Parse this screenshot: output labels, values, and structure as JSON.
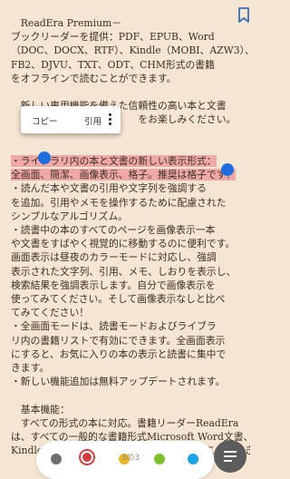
{
  "content": {
    "lines": [
      "　ReadEra Premium－",
      "ブックリーダーを提供：PDF、EPUB、Word",
      "（DOC、DOCX、RTF）、Kindle（MOBI、AZW3）、",
      "FB2、DJVU、TXT、ODT、CHM形式の書籍",
      "をオフラインで読むことができます。",
      "",
      "　新しい専用機能を備えた信頼性の高い本と文書",
      "　　　　　　　　　　　　　をお楽しみください。",
      "",
      "",
      "・ライブラリ内の本と文書の新しい表示形式：",
      "全画面、簡潔、画像表示、格子。推奨は格子です！",
      "・読んだ本や文書の引用や文字列を強調する",
      "を追加。引用やメモを操作するために配慮された",
      "シンプルなアルゴリズム。",
      "・読書中の本のすべてのページを画像表示一本",
      "や文書をすばやく視覚的に移動するのに便利です。",
      "画面表示は昼夜のカラーモードに対応し、強調",
      "表示された文字列、引用、メモ、しおりを表示し、",
      "検索結果を強調表示します。自分で画像表示を",
      "使ってみてください。そして画像表示なしと比べ",
      "てみてください！",
      "・全画面モードは、読書モードおよびライブラ",
      "リ内の書籍リストで有効にできます。全画面表示",
      "にすると、お気に入りの本の表示と読書に集中で",
      "きます。",
      "・新しい機能追加は無料アップデートされます。",
      "",
      "　基本機能：",
      "　すべての形式の本に対応。書籍リーダーReadEra",
      "は、すべての一般的な書籍形式Microsoft Word文書、や",
      "Kindleモバイル形式を、1つのアプリで読むことができます"
    ]
  },
  "popup": {
    "copy": "コピー",
    "quote": "引用"
  },
  "footer": {
    "page": "3の3"
  },
  "icons": {
    "bookmark": "bookmark-icon",
    "more": "more-vert-icon",
    "notes": "notes-icon"
  },
  "colors": {
    "highlight": "#f0a8a4",
    "handle": "#1f6fe0",
    "gray": "#6e6e6e",
    "red": "#d23d3d",
    "yellow": "#e8b828",
    "green": "#7bbf2d",
    "blue": "#1aa3e5"
  }
}
